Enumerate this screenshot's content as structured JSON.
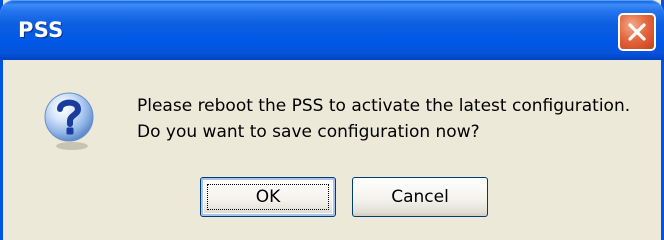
{
  "window": {
    "title": "PSS"
  },
  "dialog": {
    "message_line1": "Please reboot the PSS to activate the latest configuration.",
    "message_line2": "Do you want to save configuration now?",
    "icon": "question-icon"
  },
  "buttons": {
    "ok_label": "OK",
    "cancel_label": "Cancel"
  },
  "colors": {
    "titlebar": "#0058e6",
    "window_face": "#ece9d8",
    "close_button": "#e4683f",
    "button_border": "#003c74"
  }
}
